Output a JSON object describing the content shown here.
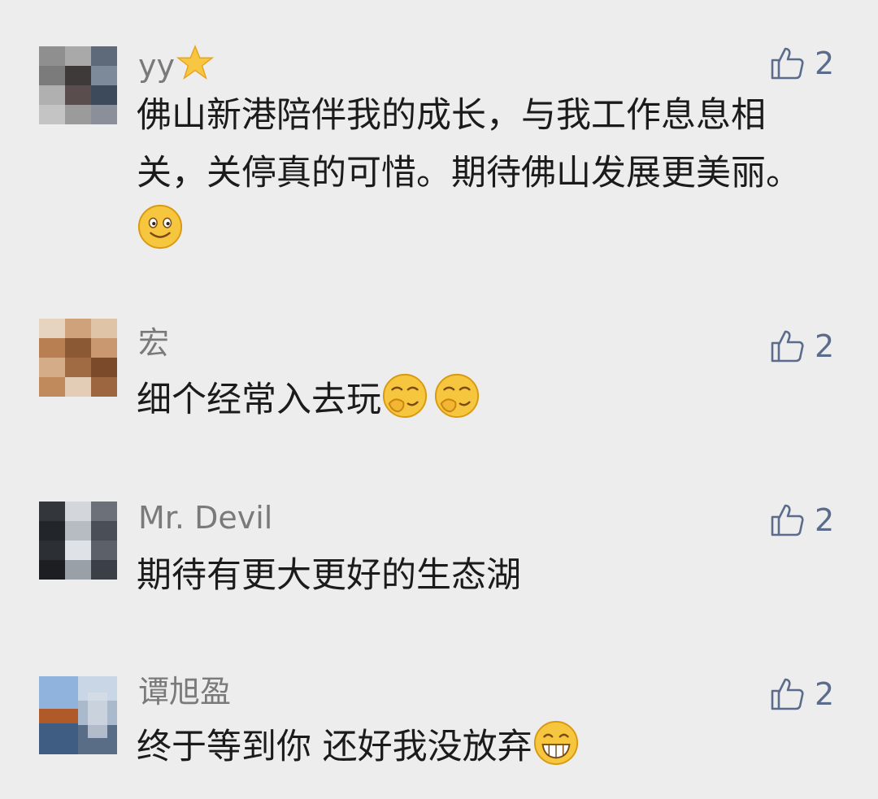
{
  "comments": [
    {
      "name": "yy",
      "name_icon": "star-emoji",
      "text": "佛山新港陪伴我的成长，与我工作息息相关，关停真的可惜。期待佛山发展更美丽。",
      "text_emojis": [
        "smile-emoji"
      ],
      "likes": "2"
    },
    {
      "name": "宏",
      "text": "细个经常入去玩",
      "text_emojis": [
        "giggle-emoji",
        "giggle-emoji"
      ],
      "likes": "2"
    },
    {
      "name": "Mr. Devil",
      "text": "期待有更大更好的生态湖",
      "text_emojis": [],
      "likes": "2"
    },
    {
      "name": "谭旭盈",
      "text": "终于等到你 还好我没放弃",
      "text_emojis": [
        "grin-emoji"
      ],
      "likes": "2"
    }
  ],
  "like_icon": "thumbs-up-icon",
  "colors": {
    "background": "#ededed",
    "name_text": "#7a7a7a",
    "body_text": "#1b1b1b",
    "like_color": "#5b6b8c"
  }
}
